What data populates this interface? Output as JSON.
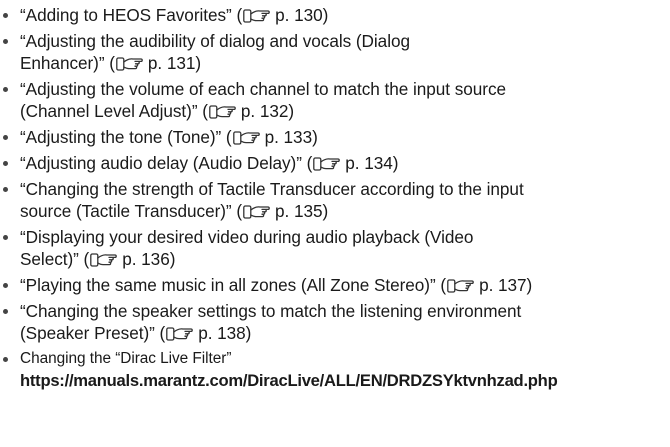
{
  "references": [
    {
      "title_lines": [
        "“Adding to HEOS Favorites” ("
      ],
      "page": "p. 130)"
    },
    {
      "title_lines": [
        "“Adjusting the audibility of dialog and vocals (Dialog",
        "Enhancer)” ("
      ],
      "page": "p. 131)"
    },
    {
      "title_lines": [
        "“Adjusting the volume of each channel to match the input source",
        "(Channel Level Adjust)” ("
      ],
      "page": "p. 132)"
    },
    {
      "title_lines": [
        "“Adjusting the tone (Tone)” ("
      ],
      "page": "p. 133)"
    },
    {
      "title_lines": [
        "“Adjusting audio delay (Audio Delay)” ("
      ],
      "page": "p. 134)"
    },
    {
      "title_lines": [
        "“Changing the strength of Tactile Transducer according to the input",
        "source (Tactile Transducer)” ("
      ],
      "page": "p. 135)"
    },
    {
      "title_lines": [
        "“Displaying your desired video during audio playback (Video",
        "Select)” ("
      ],
      "page": "p. 136)"
    },
    {
      "title_lines": [
        "“Playing the same music in all zones (All Zone Stereo)” ("
      ],
      "page": "p. 137)"
    },
    {
      "title_lines": [
        "“Changing the speaker settings to match the listening environment",
        "(Speaker Preset)” ("
      ],
      "page": "p. 138)"
    }
  ],
  "last_item": {
    "text": "Changing the “Dirac Live Filter”",
    "url": "https://manuals.marantz.com/DiracLive/ALL/EN/DRDZSYktvnhzad.php"
  },
  "icons": {
    "page_ref": "pointing-hand-icon"
  }
}
